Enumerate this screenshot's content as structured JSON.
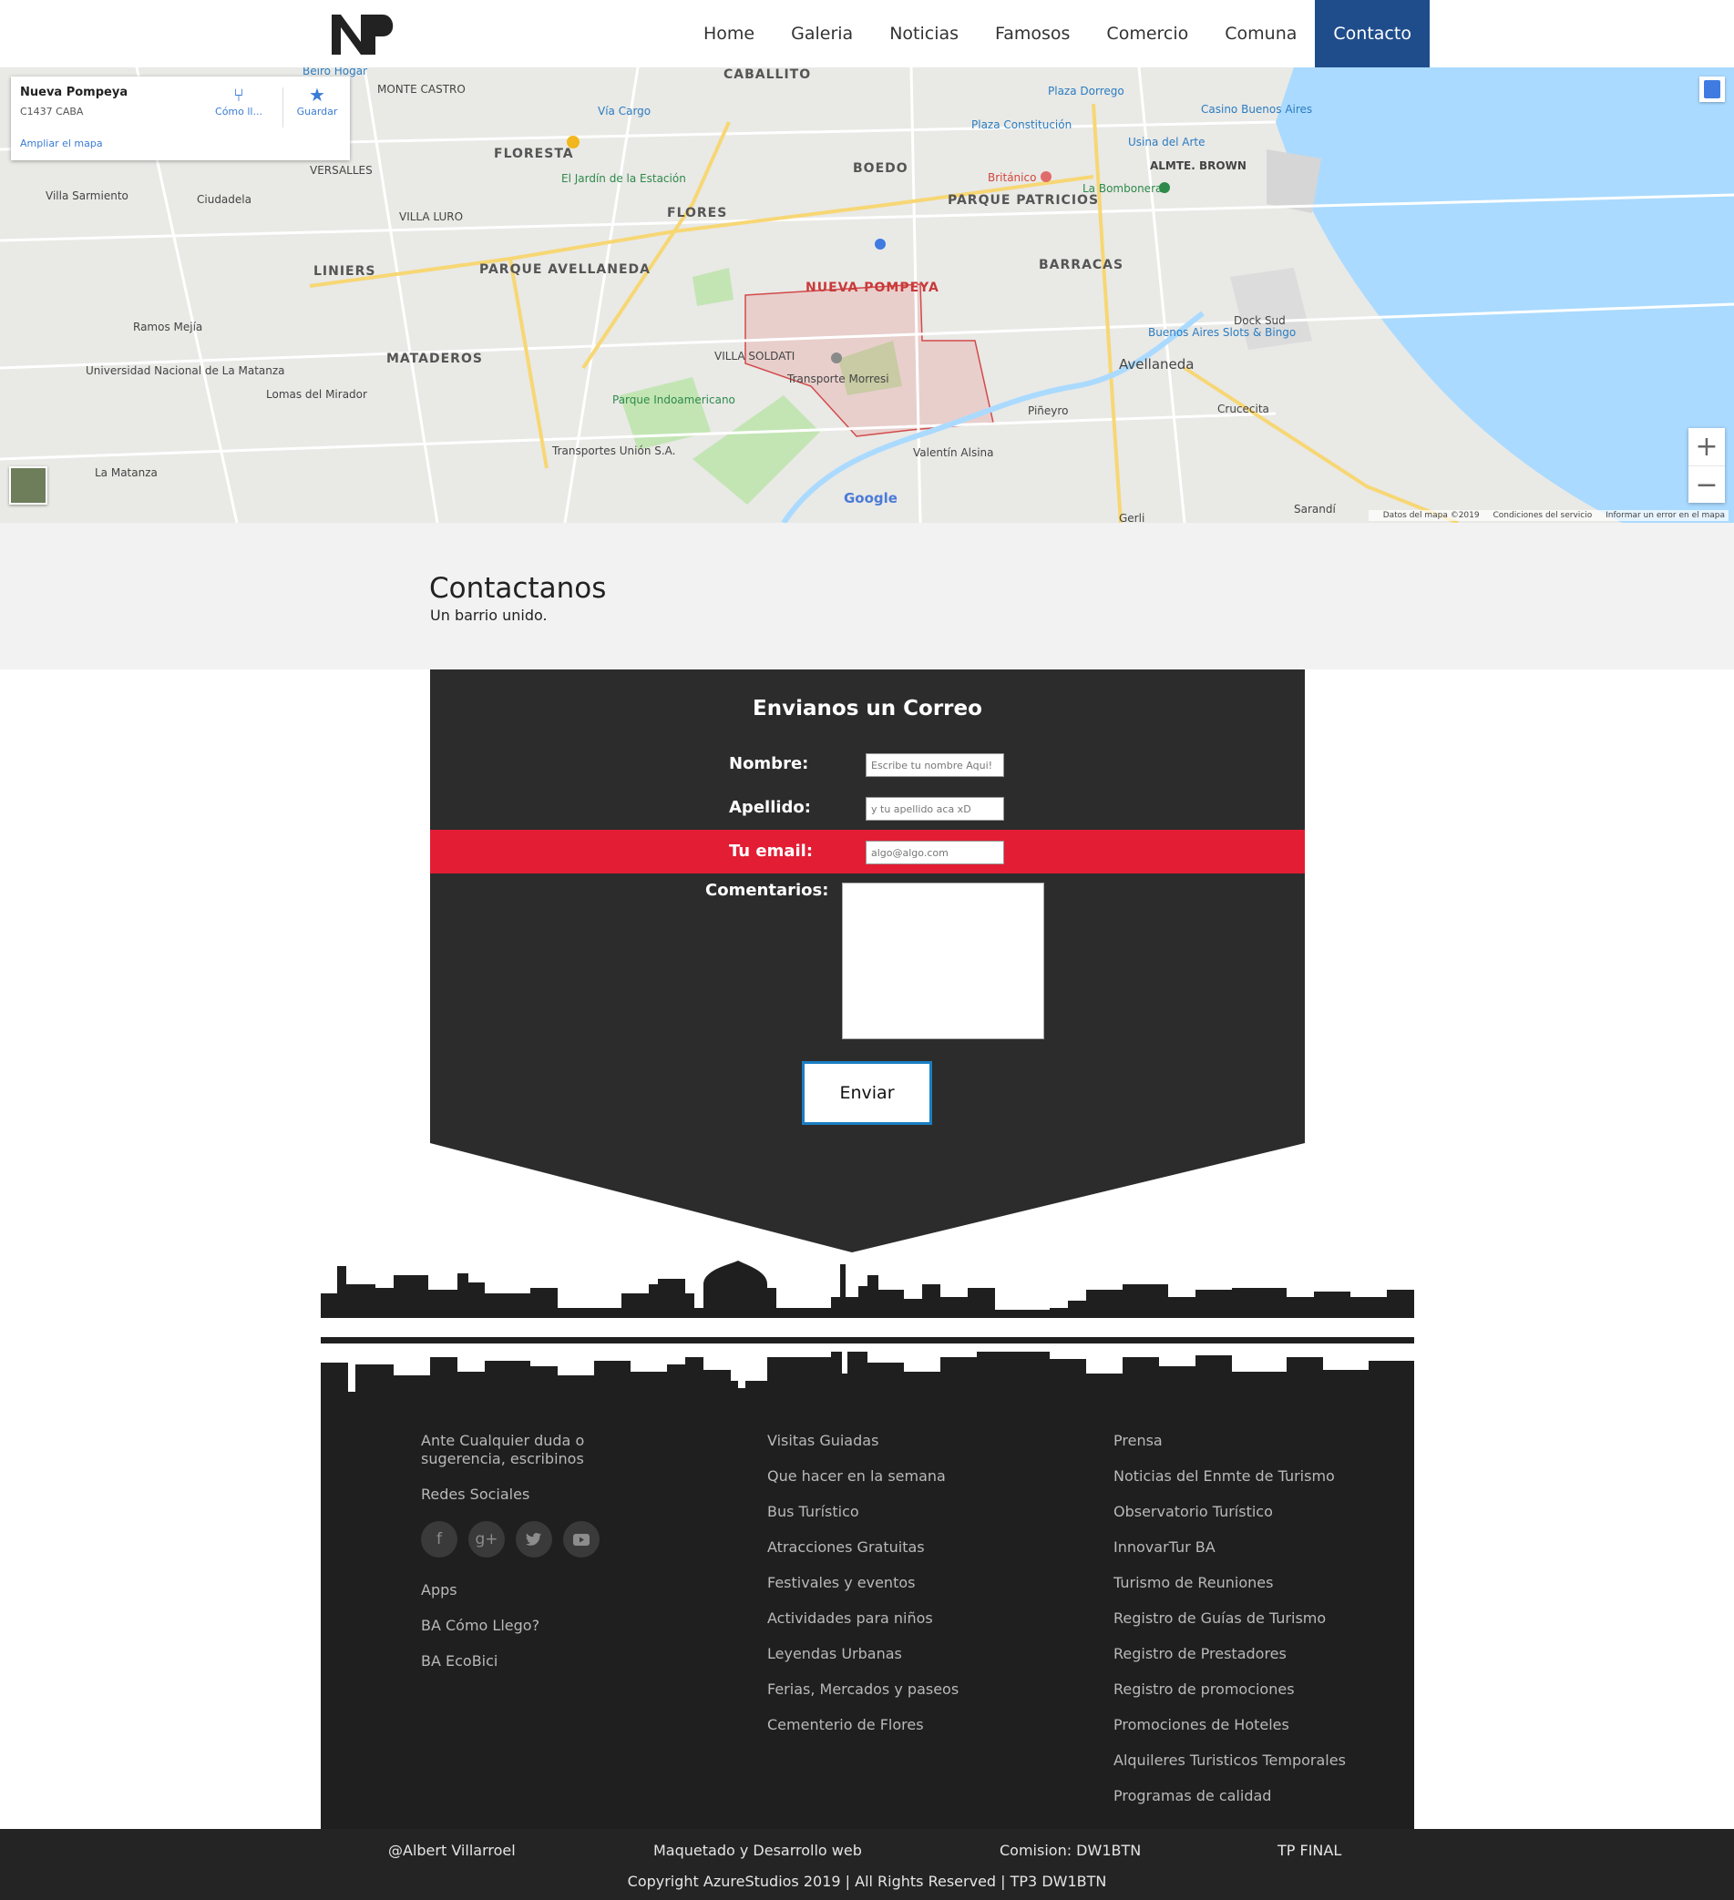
{
  "brand": {
    "logo_text": "NP",
    "accent": "#1f4d8c"
  },
  "nav": {
    "items": [
      "Home",
      "Galeria",
      "Noticias",
      "Famosos",
      "Comercio",
      "Comuna",
      "Contacto"
    ],
    "active": "Contacto"
  },
  "map": {
    "card": {
      "place": "Nueva Pompeya",
      "address": "C1437 CABA",
      "directions": "Cómo ll...",
      "save": "Guardar",
      "enlarge": "Ampliar el mapa"
    },
    "labels": {
      "caballito": "CABALLITO",
      "floresta": "FLORESTA",
      "boedo": "BOEDO",
      "flores": "FLORES",
      "parque_patricios": "PARQUE PATRICIOS",
      "barracas": "BARRACAS",
      "nueva_pompeya": "NUEVA POMPEYA",
      "liniers": "LINIERS",
      "parque_avellaneda": "PARQUE AVELLANEDA",
      "mataderos": "MATADEROS",
      "villa_soldati": "VILLA SOLDATI",
      "avellaneda": "Avellaneda",
      "ramos_mejia": "Ramos Mejía",
      "la_matanza": "La Matanza",
      "lomas_del_mirador": "Lomas del Mirador",
      "villa_sarmiento": "Villa Sarmiento",
      "ciudadela": "Ciudadela",
      "monte_castro": "MONTE CASTRO",
      "versalles": "VERSALLES",
      "villa_luro": "VILLA LURO",
      "pineyro": "Piñeyro",
      "valentin_alsina": "Valentín Alsina",
      "crucecita": "Crucecita",
      "dock_sud": "Dock Sud",
      "sarandi": "Sarandí",
      "gerli": "Gerli",
      "plaza_dorrego": "Plaza Dorrego",
      "plaza_constitucion": "Plaza Constitución",
      "casino": "Casino Buenos Aires",
      "la_bombonera": "La Bombonera",
      "usina": "Usina del Arte",
      "britanico": "Británico",
      "via_cargo": "Vía Cargo",
      "jardin": "El Jardín de la Estación",
      "transporte_morresi": "Transporte Morresi",
      "parque_indoamericano": "Parque Indoamericano",
      "transportes_union": "Transportes Unión S.A.",
      "universidad": "Universidad Nacional de La Matanza",
      "buenos_aires_slots": "Buenos Aires Slots & Bingo",
      "almte_brown": "ALMTE. BROWN",
      "beiro_hogar": "Beiro Hogar",
      "google": "Google"
    },
    "footer": [
      "Datos del mapa ©2019",
      "Condiciones del servicio",
      "Informar un error en el mapa"
    ]
  },
  "contact": {
    "title": "Contactanos",
    "subtitle": "Un barrio unido."
  },
  "form": {
    "title": "Envianos un Correo",
    "name_label": "Nombre:",
    "name_placeholder": "Escribe tu nombre Aqui!",
    "surname_label": "Apellido:",
    "surname_placeholder": "y tu apellido aca xD",
    "email_label": "Tu email:",
    "email_placeholder": "algo@algo.com",
    "comments_label": "Comentarios:",
    "submit": "Enviar",
    "panel_color": "#2c2c2c",
    "highlight_color": "#e21d34",
    "button_border": "#1a7ec2"
  },
  "footer": {
    "col1": {
      "intro": "Ante Cualquier duda o sugerencia, escribinos",
      "social_title": "Redes Sociales",
      "socials": [
        "facebook-icon",
        "google-plus-icon",
        "twitter-icon",
        "youtube-icon"
      ],
      "apps_title": "Apps",
      "apps": [
        "BA Cómo Llego?",
        "BA EcoBici"
      ]
    },
    "col2": [
      "Visitas Guiadas",
      "Que hacer en la semana",
      "Bus Turístico",
      "Atracciones Gratuitas",
      "Festivales y eventos",
      "Actividades para niños",
      "Leyendas Urbanas",
      "Ferias, Mercados y paseos",
      "Cementerio de Flores"
    ],
    "col3": [
      "Prensa",
      "Noticias del Enmte de Turismo",
      "Observatorio Turístico",
      "InnovarTur BA",
      "Turismo de Reuniones",
      "Registro de Guías de Turismo",
      "Registro de Prestadores",
      "Registro de promociones",
      "Promociones de Hoteles",
      "Alquileres Turisticos Temporales",
      "Programas de calidad"
    ]
  },
  "bottom": {
    "author": "@Albert Villarroel",
    "work": "Maquetado y Desarrollo web",
    "commission": "Comision: DW1BTN",
    "project": "TP FINAL",
    "copyright": "Copyright AzureStudios 2019 | All Rights Reserved | TP3 DW1BTN"
  }
}
